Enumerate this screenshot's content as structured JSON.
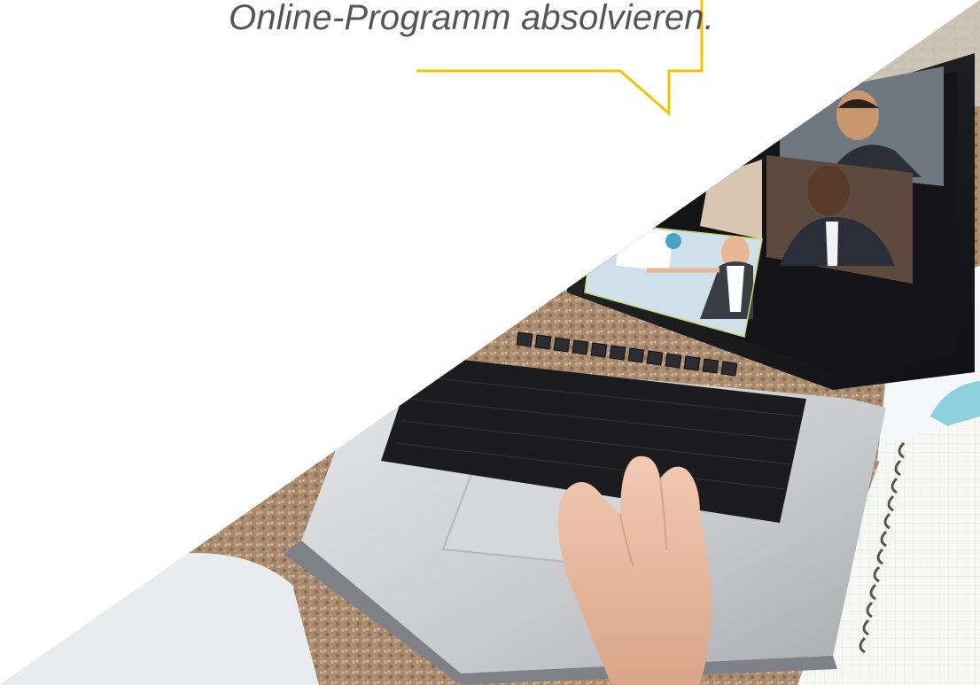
{
  "callout": {
    "text": "Online-Programm absolvieren.",
    "accent_color": "#F2C500"
  },
  "photo": {
    "subject": "laptop-video-call-image"
  }
}
